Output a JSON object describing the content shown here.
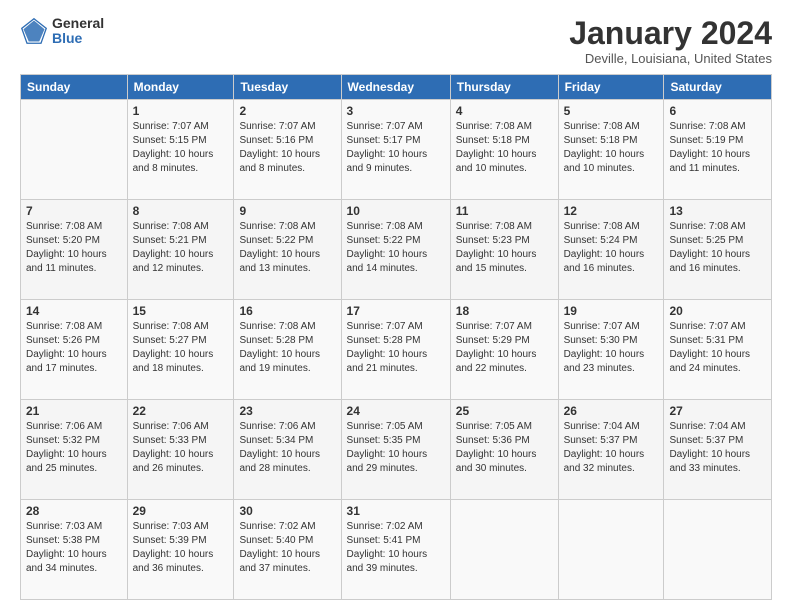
{
  "logo": {
    "general": "General",
    "blue": "Blue"
  },
  "header": {
    "title": "January 2024",
    "location": "Deville, Louisiana, United States"
  },
  "weekdays": [
    "Sunday",
    "Monday",
    "Tuesday",
    "Wednesday",
    "Thursday",
    "Friday",
    "Saturday"
  ],
  "weeks": [
    [
      {
        "day": "",
        "info": ""
      },
      {
        "day": "1",
        "info": "Sunrise: 7:07 AM\nSunset: 5:15 PM\nDaylight: 10 hours\nand 8 minutes."
      },
      {
        "day": "2",
        "info": "Sunrise: 7:07 AM\nSunset: 5:16 PM\nDaylight: 10 hours\nand 8 minutes."
      },
      {
        "day": "3",
        "info": "Sunrise: 7:07 AM\nSunset: 5:17 PM\nDaylight: 10 hours\nand 9 minutes."
      },
      {
        "day": "4",
        "info": "Sunrise: 7:08 AM\nSunset: 5:18 PM\nDaylight: 10 hours\nand 10 minutes."
      },
      {
        "day": "5",
        "info": "Sunrise: 7:08 AM\nSunset: 5:18 PM\nDaylight: 10 hours\nand 10 minutes."
      },
      {
        "day": "6",
        "info": "Sunrise: 7:08 AM\nSunset: 5:19 PM\nDaylight: 10 hours\nand 11 minutes."
      }
    ],
    [
      {
        "day": "7",
        "info": "Sunrise: 7:08 AM\nSunset: 5:20 PM\nDaylight: 10 hours\nand 11 minutes."
      },
      {
        "day": "8",
        "info": "Sunrise: 7:08 AM\nSunset: 5:21 PM\nDaylight: 10 hours\nand 12 minutes."
      },
      {
        "day": "9",
        "info": "Sunrise: 7:08 AM\nSunset: 5:22 PM\nDaylight: 10 hours\nand 13 minutes."
      },
      {
        "day": "10",
        "info": "Sunrise: 7:08 AM\nSunset: 5:22 PM\nDaylight: 10 hours\nand 14 minutes."
      },
      {
        "day": "11",
        "info": "Sunrise: 7:08 AM\nSunset: 5:23 PM\nDaylight: 10 hours\nand 15 minutes."
      },
      {
        "day": "12",
        "info": "Sunrise: 7:08 AM\nSunset: 5:24 PM\nDaylight: 10 hours\nand 16 minutes."
      },
      {
        "day": "13",
        "info": "Sunrise: 7:08 AM\nSunset: 5:25 PM\nDaylight: 10 hours\nand 16 minutes."
      }
    ],
    [
      {
        "day": "14",
        "info": "Sunrise: 7:08 AM\nSunset: 5:26 PM\nDaylight: 10 hours\nand 17 minutes."
      },
      {
        "day": "15",
        "info": "Sunrise: 7:08 AM\nSunset: 5:27 PM\nDaylight: 10 hours\nand 18 minutes."
      },
      {
        "day": "16",
        "info": "Sunrise: 7:08 AM\nSunset: 5:28 PM\nDaylight: 10 hours\nand 19 minutes."
      },
      {
        "day": "17",
        "info": "Sunrise: 7:07 AM\nSunset: 5:28 PM\nDaylight: 10 hours\nand 21 minutes."
      },
      {
        "day": "18",
        "info": "Sunrise: 7:07 AM\nSunset: 5:29 PM\nDaylight: 10 hours\nand 22 minutes."
      },
      {
        "day": "19",
        "info": "Sunrise: 7:07 AM\nSunset: 5:30 PM\nDaylight: 10 hours\nand 23 minutes."
      },
      {
        "day": "20",
        "info": "Sunrise: 7:07 AM\nSunset: 5:31 PM\nDaylight: 10 hours\nand 24 minutes."
      }
    ],
    [
      {
        "day": "21",
        "info": "Sunrise: 7:06 AM\nSunset: 5:32 PM\nDaylight: 10 hours\nand 25 minutes."
      },
      {
        "day": "22",
        "info": "Sunrise: 7:06 AM\nSunset: 5:33 PM\nDaylight: 10 hours\nand 26 minutes."
      },
      {
        "day": "23",
        "info": "Sunrise: 7:06 AM\nSunset: 5:34 PM\nDaylight: 10 hours\nand 28 minutes."
      },
      {
        "day": "24",
        "info": "Sunrise: 7:05 AM\nSunset: 5:35 PM\nDaylight: 10 hours\nand 29 minutes."
      },
      {
        "day": "25",
        "info": "Sunrise: 7:05 AM\nSunset: 5:36 PM\nDaylight: 10 hours\nand 30 minutes."
      },
      {
        "day": "26",
        "info": "Sunrise: 7:04 AM\nSunset: 5:37 PM\nDaylight: 10 hours\nand 32 minutes."
      },
      {
        "day": "27",
        "info": "Sunrise: 7:04 AM\nSunset: 5:37 PM\nDaylight: 10 hours\nand 33 minutes."
      }
    ],
    [
      {
        "day": "28",
        "info": "Sunrise: 7:03 AM\nSunset: 5:38 PM\nDaylight: 10 hours\nand 34 minutes."
      },
      {
        "day": "29",
        "info": "Sunrise: 7:03 AM\nSunset: 5:39 PM\nDaylight: 10 hours\nand 36 minutes."
      },
      {
        "day": "30",
        "info": "Sunrise: 7:02 AM\nSunset: 5:40 PM\nDaylight: 10 hours\nand 37 minutes."
      },
      {
        "day": "31",
        "info": "Sunrise: 7:02 AM\nSunset: 5:41 PM\nDaylight: 10 hours\nand 39 minutes."
      },
      {
        "day": "",
        "info": ""
      },
      {
        "day": "",
        "info": ""
      },
      {
        "day": "",
        "info": ""
      }
    ]
  ]
}
